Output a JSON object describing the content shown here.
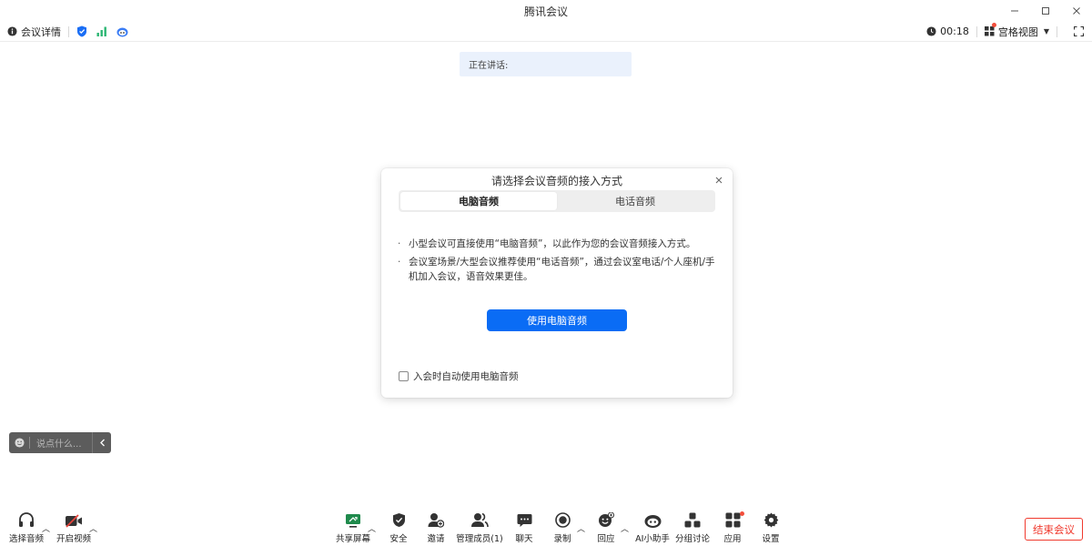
{
  "window": {
    "title": "腾讯会议"
  },
  "topbar": {
    "meeting_info": "会议详情",
    "timer": "00:18",
    "view_mode": "宫格视图"
  },
  "speaking": {
    "label": "正在讲话:"
  },
  "dialog": {
    "title": "请选择会议音频的接入方式",
    "tabs": [
      {
        "label": "电脑音频",
        "active": true
      },
      {
        "label": "电话音频",
        "active": false
      }
    ],
    "tips": [
      "小型会议可直接使用“电脑音频”，以此作为您的会议音频接入方式。",
      "会议室场景/大型会议推荐使用“电话音频”，通过会议室电话/个人座机/手机加入会议，语音效果更佳。"
    ],
    "primary_button": "使用电脑音频",
    "auto_checkbox": {
      "label": "入会时自动使用电脑音频",
      "checked": false
    }
  },
  "chat": {
    "placeholder": "说点什么..."
  },
  "toolbar": {
    "audio": "选择音频",
    "video": "开启视频",
    "share": "共享屏幕",
    "security": "安全",
    "invite": "邀请",
    "members": "管理成员(1)",
    "chat": "聊天",
    "record": "录制",
    "react": "回应",
    "ai": "AI小助手",
    "breakout": "分组讨论",
    "apps": "应用",
    "settings": "设置"
  },
  "end_button": "结束会议",
  "colors": {
    "primary": "#0a6cf5",
    "danger": "#f03a2e",
    "speaking_bg": "#eaf1fc",
    "security_green": "#2bb673"
  }
}
